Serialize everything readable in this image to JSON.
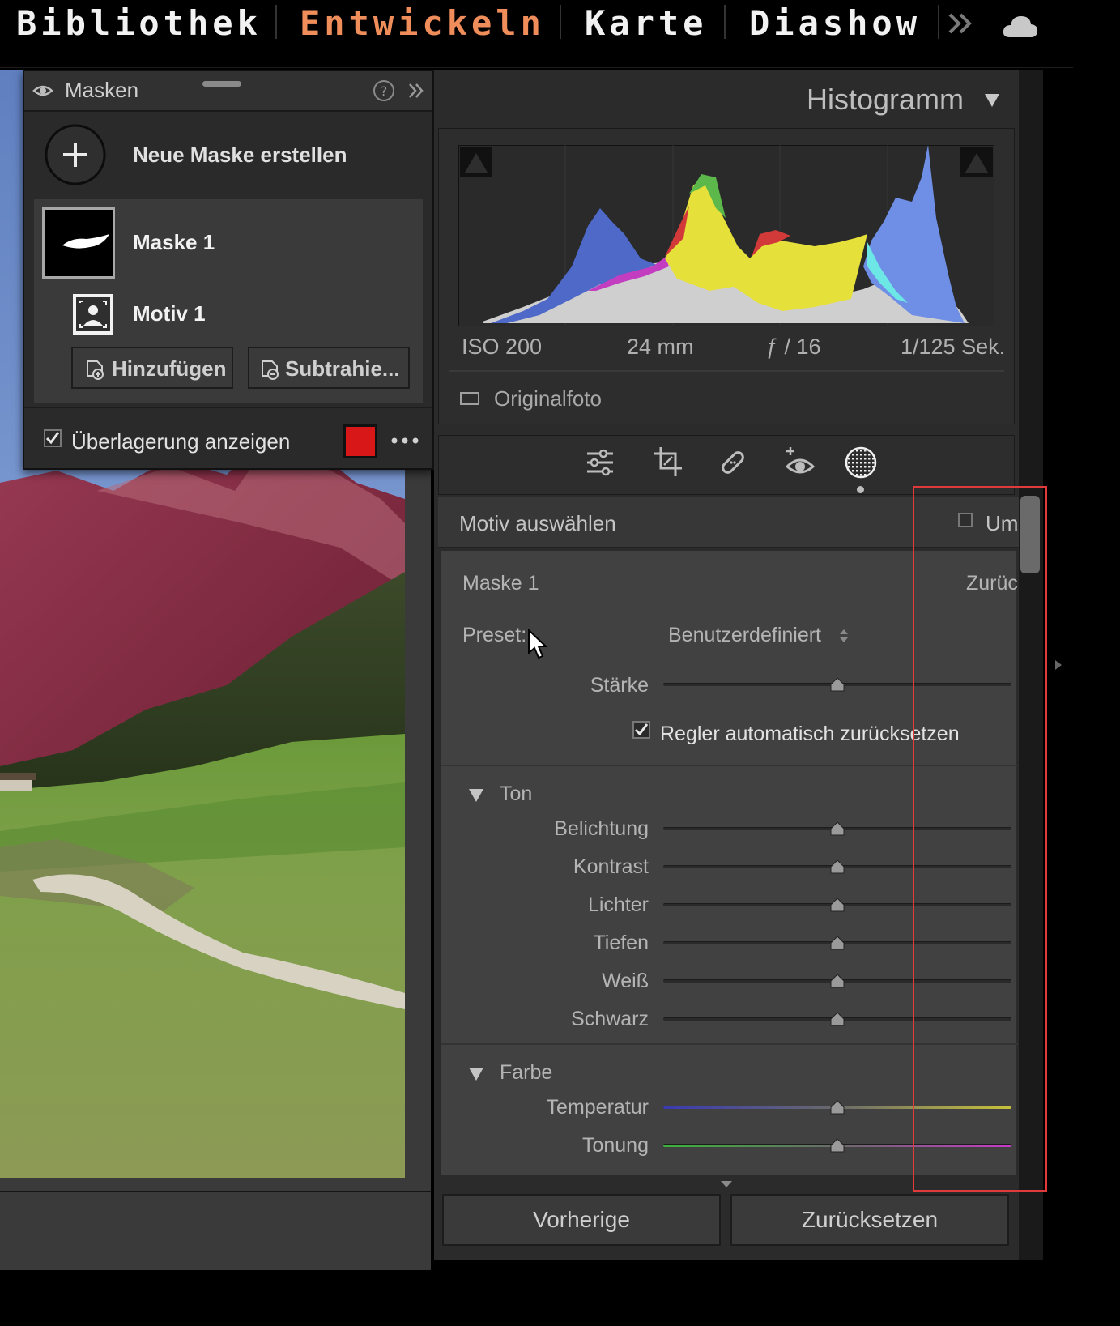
{
  "modules": [
    {
      "label": "Bibliothek",
      "active": false
    },
    {
      "label": "Entwickeln",
      "active": true
    },
    {
      "label": "Karte",
      "active": false
    },
    {
      "label": "Diashow",
      "active": false
    }
  ],
  "masks_panel": {
    "title": "Masken",
    "new_mask_label": "Neue Maske erstellen",
    "mask_name": "Maske 1",
    "component_name": "Motiv 1",
    "add_label": "Hinzufügen",
    "subtract_label": "Subtrahie...",
    "overlay_label": "Überlagerung anzeigen",
    "overlay_checked": true,
    "overlay_color": "#d81818"
  },
  "histogram": {
    "title": "Histogramm",
    "iso": "ISO 200",
    "focal": "24 mm",
    "aperture": "ƒ / 16",
    "shutter": "1/125 Sek.",
    "original_label": "Originalfoto"
  },
  "mask_settings": {
    "section_title": "Motiv auswählen",
    "invert_label": "Um",
    "mask_label": "Maske 1",
    "reset_short": "Zurüc",
    "preset_label": "Preset:",
    "preset_value": "Benutzerdefiniert",
    "strength_label": "Stärke",
    "auto_reset_label": "Regler automatisch zurücksetzen",
    "auto_reset_checked": true,
    "strength_value": 0.5
  },
  "tone": {
    "title": "Ton",
    "sliders": [
      {
        "label": "Belichtung",
        "value": 0
      },
      {
        "label": "Kontrast",
        "value": 0
      },
      {
        "label": "Lichter",
        "value": 0
      },
      {
        "label": "Tiefen",
        "value": 0
      },
      {
        "label": "Weiß",
        "value": 0
      },
      {
        "label": "Schwarz",
        "value": 0
      }
    ]
  },
  "color": {
    "title": "Farbe",
    "sliders": [
      {
        "label": "Temperatur",
        "value": 0
      },
      {
        "label": "Tonung",
        "value": 0
      }
    ]
  },
  "footer": {
    "previous_label": "Vorherige",
    "reset_label": "Zurücksetzen"
  },
  "accent": "#f08e5b",
  "highlight_color": "#e03a3a"
}
